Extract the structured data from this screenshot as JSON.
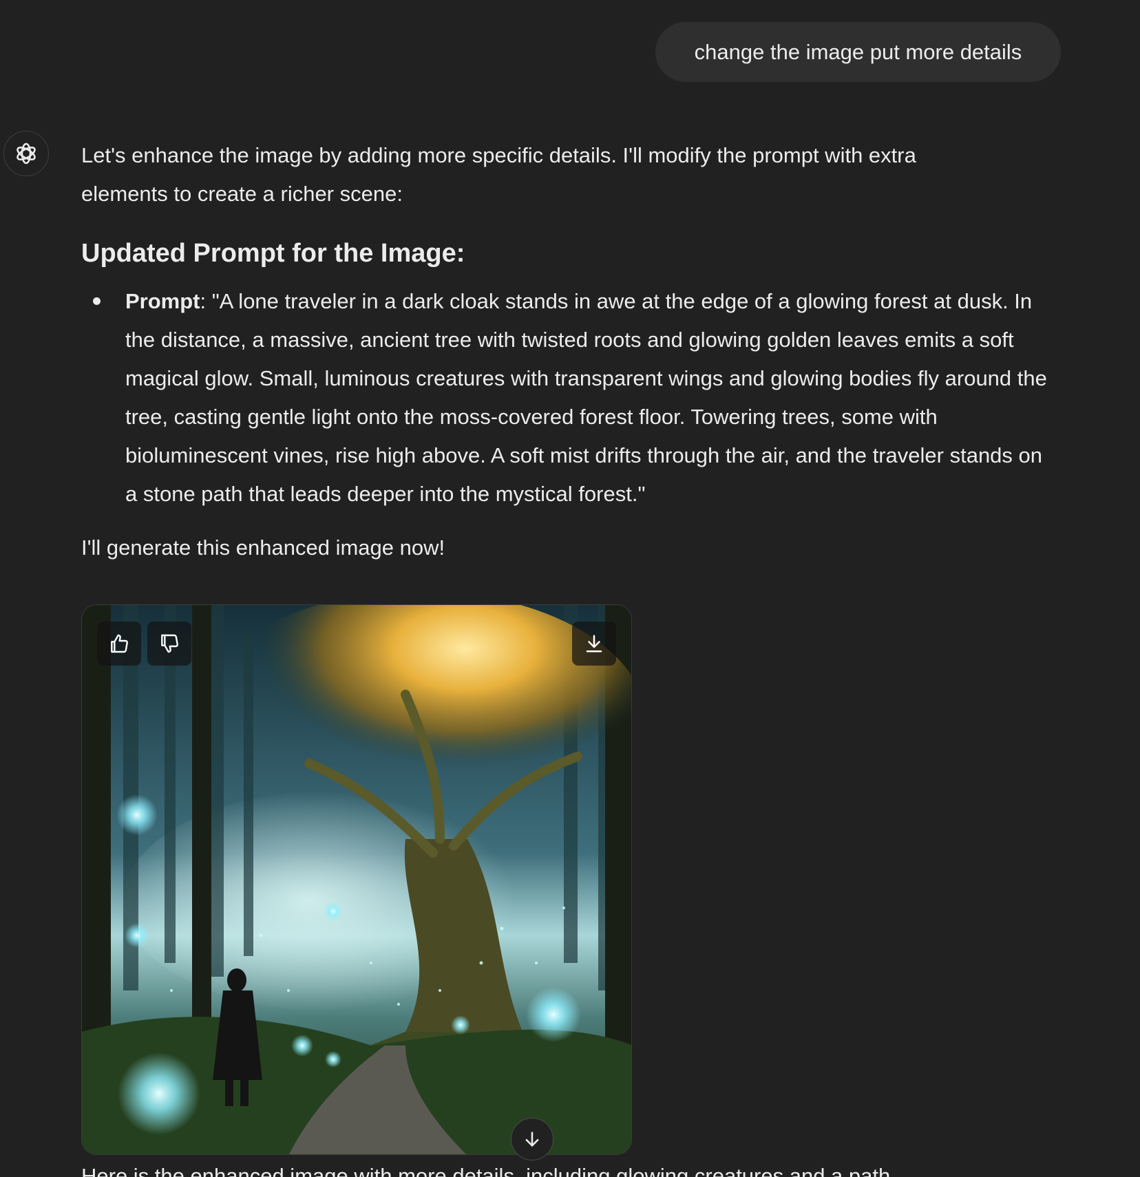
{
  "user_message": {
    "text": "change the image put more details"
  },
  "assistant": {
    "intro": "Let's enhance the image by adding more specific details. I'll modify the prompt with extra elements to create a richer scene:",
    "heading": "Updated Prompt for the Image:",
    "bullets": [
      {
        "label": "Prompt",
        "text": ": \"A lone traveler in a dark cloak stands in awe at the edge of a glowing forest at dusk. In the distance, a massive, ancient tree with twisted roots and glowing golden leaves emits a soft magical glow. Small, luminous creatures with transparent wings and glowing bodies fly around the tree, casting gentle light onto the moss-covered forest floor. Towering trees, some with bioluminescent vines, rise high above. A soft mist drifts through the air, and the traveler stands on a stone path that leads deeper into the mystical forest.\""
      }
    ],
    "outro": "I'll generate this enhanced image now!",
    "cut_off_line": "Here is the enhanced image with more details, including glowing creatures and a path"
  },
  "image_toolbar": {
    "like_icon": "thumbs-up-icon",
    "dislike_icon": "thumbs-down-icon",
    "download_icon": "download-icon"
  },
  "scroll_down_icon": "arrow-down-icon",
  "colors": {
    "background": "#212121",
    "user_bubble": "#2f2f2f",
    "text": "#ececec",
    "glow_gold": "#f5c542",
    "glow_cyan": "#9ff5ff"
  }
}
